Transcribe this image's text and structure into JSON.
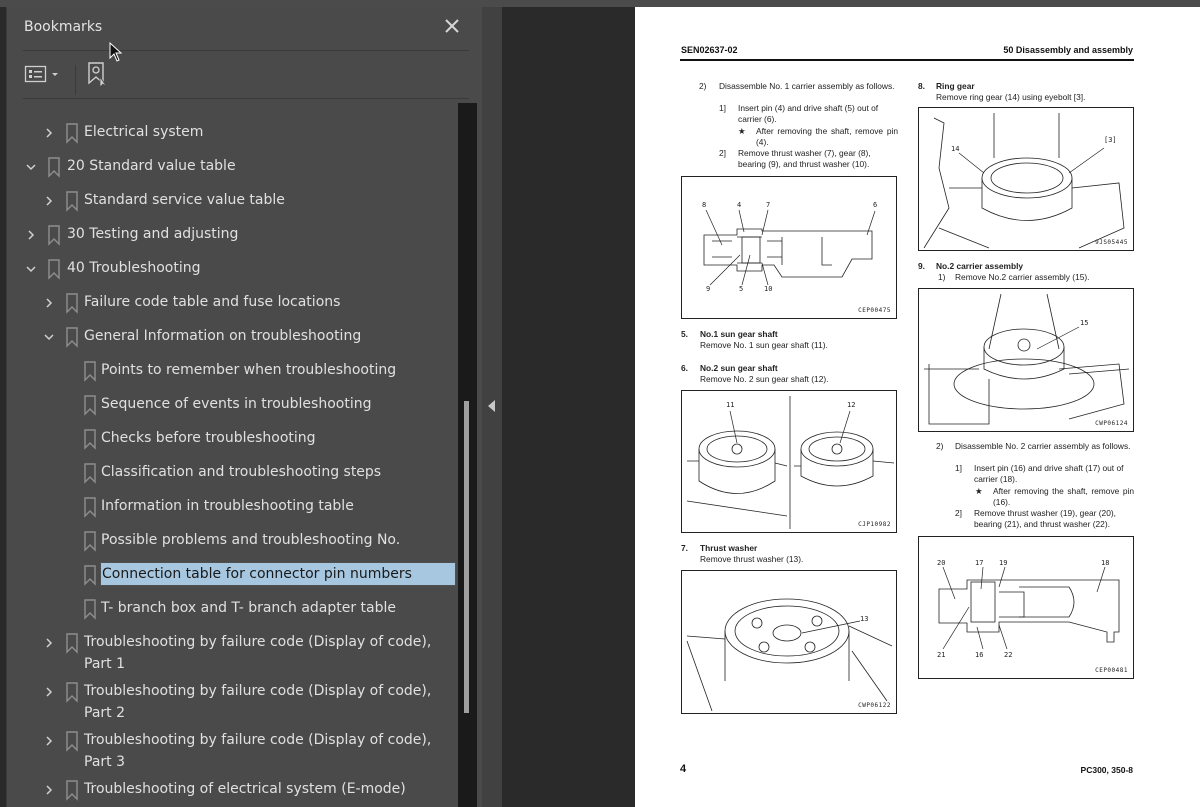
{
  "panel": {
    "title": "Bookmarks",
    "close_icon": "close-icon",
    "options_icon": "list-options-icon",
    "find_icon": "find-current-bookmark-icon"
  },
  "bookmarks": [
    {
      "label": "Electrical system",
      "level": 1,
      "expander": "collapsed"
    },
    {
      "label": "20 Standard value table",
      "level": 0,
      "expander": "expanded"
    },
    {
      "label": "Standard service value table",
      "level": 1,
      "expander": "collapsed"
    },
    {
      "label": "30 Testing and adjusting",
      "level": 0,
      "expander": "collapsed"
    },
    {
      "label": "40 Troubleshooting",
      "level": 0,
      "expander": "expanded"
    },
    {
      "label": "Failure code table and fuse locations",
      "level": 1,
      "expander": "collapsed"
    },
    {
      "label": "General Information on troubleshooting",
      "level": 1,
      "expander": "expanded"
    },
    {
      "label": "Points to remember when troubleshooting",
      "level": 2,
      "expander": "none"
    },
    {
      "label": "Sequence of events in troubleshooting",
      "level": 2,
      "expander": "none"
    },
    {
      "label": "Checks before troubleshooting",
      "level": 2,
      "expander": "none"
    },
    {
      "label": "Classification and troubleshooting steps",
      "level": 2,
      "expander": "none"
    },
    {
      "label": "Information in troubleshooting table",
      "level": 2,
      "expander": "none"
    },
    {
      "label": "Possible problems and troubleshooting No.",
      "level": 2,
      "expander": "none"
    },
    {
      "label": "Connection table for connector pin numbers",
      "level": 2,
      "expander": "none",
      "selected": true
    },
    {
      "label": "T- branch box and T- branch adapter table",
      "level": 2,
      "expander": "none"
    },
    {
      "label": "Troubleshooting by failure code (Display of code), Part 1",
      "level": 1,
      "expander": "collapsed"
    },
    {
      "label": "Troubleshooting by failure code (Display of code), Part 2",
      "level": 1,
      "expander": "collapsed"
    },
    {
      "label": "Troubleshooting by failure code (Display of code), Part 3",
      "level": 1,
      "expander": "collapsed"
    },
    {
      "label": "Troubleshooting of electrical system (E-mode)",
      "level": 1,
      "expander": "collapsed"
    }
  ],
  "colors": {
    "panel_bg": "#4a4a4a",
    "selection_bg": "#a7c7e0",
    "viewer_bg": "#2a2a2a",
    "page_bg": "#ffffff"
  },
  "document": {
    "header_left": "SEN02637-02",
    "header_right": "50 Disassembly and assembly",
    "page_number": "4",
    "model": "PC300, 350-8",
    "left_col": {
      "step2_num": "2)",
      "step2_text": "Disassemble No. 1 carrier assembly as follows.",
      "sub1_num": "1]",
      "sub1_text": "Insert pin (4) and drive shaft (5) out of carrier (6).",
      "note1_star": "★",
      "note1_text": "After removing the shaft, remove pin (4).",
      "sub2_num": "2]",
      "sub2_text": "Remove thrust washer (7), gear (8), bearing (9), and thrust washer (10).",
      "fig1_code": "CEP00475",
      "fig1_callouts": [
        "8",
        "4",
        "7",
        "6",
        "9",
        "5",
        "10"
      ],
      "sec5_num": "5.",
      "sec5_title": "No.1 sun gear shaft",
      "sec5_text": "Remove No. 1 sun gear shaft (11).",
      "sec6_num": "6.",
      "sec6_title": "No.2 sun gear shaft",
      "sec6_text": "Remove No. 2 sun gear shaft (12).",
      "fig2_code": "CJP10982",
      "fig2_callouts": [
        "11",
        "12"
      ],
      "sec7_num": "7.",
      "sec7_title": "Thrust washer",
      "sec7_text": "Remove thrust washer (13).",
      "fig3_code": "CWP06122",
      "fig3_callouts": [
        "13"
      ]
    },
    "right_col": {
      "sec8_num": "8.",
      "sec8_title": "Ring gear",
      "sec8_text": "Remove ring gear (14) using eyebolt [3].",
      "fig4_code": "9JS05445",
      "fig4_callouts": [
        "14",
        "[3]"
      ],
      "sec9_num": "9.",
      "sec9_title": "No.2 carrier assembly",
      "sec9_sub_num": "1)",
      "sec9_sub_text": "Remove No.2 carrier assembly (15).",
      "fig5_code": "CWP06124",
      "fig5_callouts": [
        "15"
      ],
      "step2_num": "2)",
      "step2_text": "Disassemble No. 2 carrier assembly as follows.",
      "sub1_num": "1]",
      "sub1_text": "Insert pin (16) and drive shaft (17) out of carrier (18).",
      "note1_star": "★",
      "note1_text": "After removing the shaft, remove pin (16).",
      "sub2_num": "2]",
      "sub2_text": "Remove thrust washer (19), gear (20), bearing (21), and thrust washer (22).",
      "fig6_code": "CEP00481",
      "fig6_callouts": [
        "20",
        "17",
        "19",
        "18",
        "21",
        "16",
        "22"
      ]
    }
  }
}
